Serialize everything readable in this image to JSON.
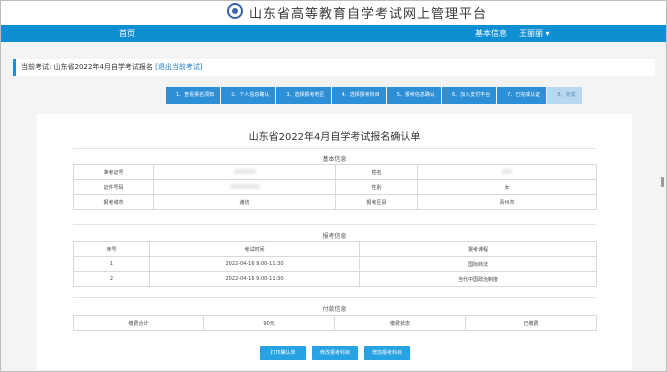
{
  "header": {
    "title": "山东省高等教育自学考试网上管理平台"
  },
  "nav": {
    "home": "首页",
    "basic_info": "基本信息",
    "user": "王丽丽 ▾"
  },
  "current_exam": {
    "label": "当前考试:",
    "value": "山东省2022年4月自学考试报名",
    "switch_link": "[退出当前考试]"
  },
  "steps": [
    "1、查看报名须知",
    "2、个人信息确认",
    "3、选择报考地区",
    "4、选择报考科目",
    "5、报考信息确认",
    "6、加入支付平台",
    "7、已完成认证",
    "8、完成"
  ],
  "form": {
    "title": "山东省2022年4月自学考试报名确认单",
    "basic_section": "基本信息",
    "basic_rows": [
      [
        "准考证号",
        "",
        "姓名",
        ""
      ],
      [
        "证件号码",
        "",
        "性别",
        "女"
      ],
      [
        "报考城市",
        "潍坊",
        "报考区县",
        "青州市"
      ]
    ],
    "exam_section": "报考信息",
    "exam_headers": [
      "序号",
      "考试时间",
      "报考课程"
    ],
    "exam_rows": [
      [
        "1",
        "2022-04-16 9:00-11:30",
        "国际商法"
      ],
      [
        "2",
        "2022-04-16 9:00-11:30",
        "当代中国政治制度"
      ]
    ],
    "pay_section": "付款信息",
    "pay_row": [
      "缴费合计",
      "90元",
      "缴费状态",
      "已缴费"
    ]
  },
  "buttons": {
    "print": "打印确认单",
    "modify": "修改报考科目",
    "add": "增加报考科目"
  }
}
